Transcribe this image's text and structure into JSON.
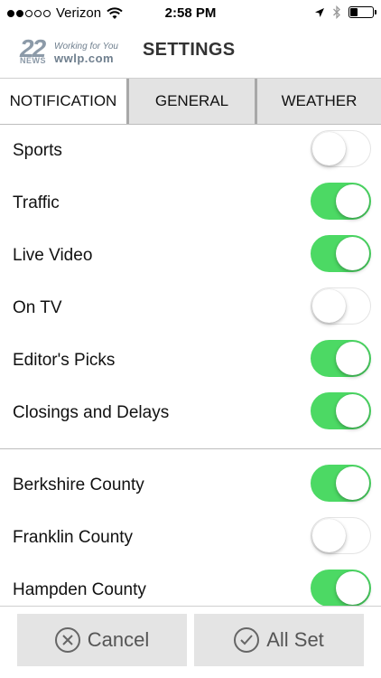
{
  "status_bar": {
    "carrier": "Verizon",
    "time": "2:58 PM",
    "signal_bars_filled": 2,
    "signal_bars_total": 5,
    "battery_level": 0.35
  },
  "header": {
    "logo": {
      "number": "22",
      "news": "NEWS",
      "tagline": "Working for You",
      "url": "wwlp.com"
    },
    "title": "SETTINGS"
  },
  "tabs": [
    {
      "label": "NOTIFICATION",
      "active": true
    },
    {
      "label": "GENERAL",
      "active": false
    },
    {
      "label": "WEATHER",
      "active": false
    }
  ],
  "notifications": [
    {
      "label": "Sports",
      "on": false
    },
    {
      "label": "Traffic",
      "on": true
    },
    {
      "label": "Live Video",
      "on": true
    },
    {
      "label": "On TV",
      "on": false
    },
    {
      "label": "Editor's Picks",
      "on": true
    },
    {
      "label": "Closings and Delays",
      "on": true
    }
  ],
  "counties": [
    {
      "label": "Berkshire County",
      "on": true
    },
    {
      "label": "Franklin County",
      "on": false
    },
    {
      "label": "Hampden County",
      "on": true
    }
  ],
  "footer": {
    "cancel_label": "Cancel",
    "allset_label": "All Set"
  },
  "colors": {
    "toggle_on": "#4cd964",
    "tab_inactive": "#e3e3e3",
    "button_bg": "#e4e4e4"
  }
}
